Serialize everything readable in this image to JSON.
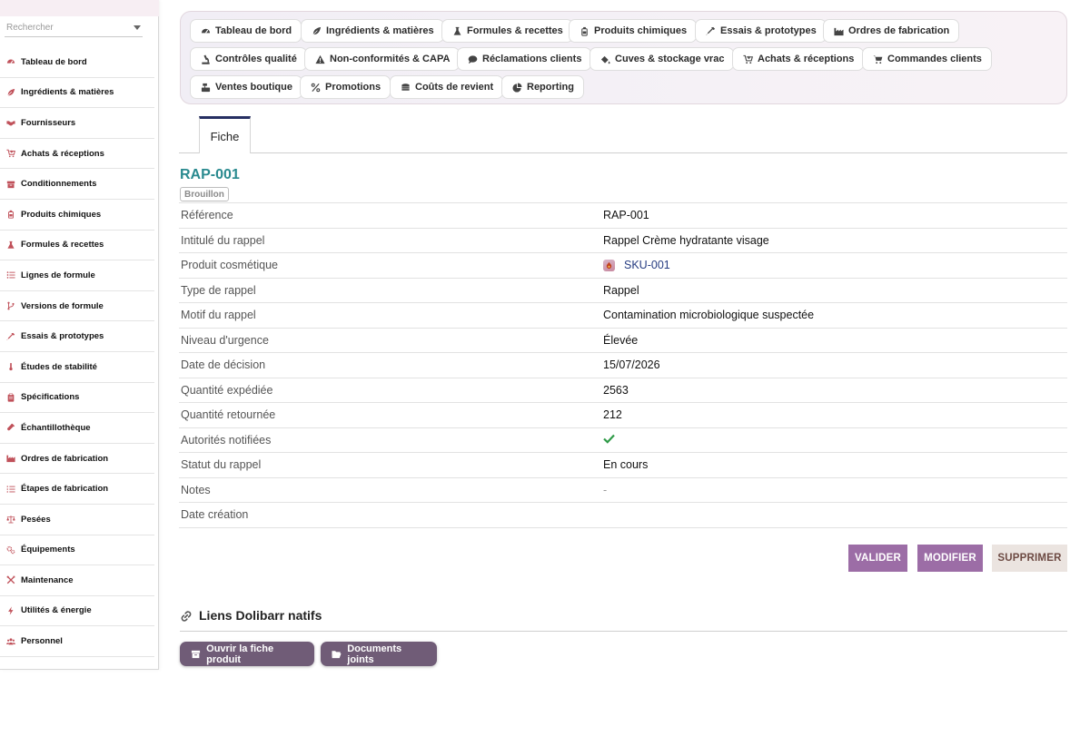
{
  "search": {
    "placeholder": "Rechercher"
  },
  "sidebar": {
    "items": [
      {
        "label": "Tableau de bord",
        "icon": "dashboard-icon"
      },
      {
        "label": "Ingrédients & matières",
        "icon": "leaf-icon"
      },
      {
        "label": "Fournisseurs",
        "icon": "handshake-icon"
      },
      {
        "label": "Achats & réceptions",
        "icon": "cart-arrow-icon"
      },
      {
        "label": "Conditionnements",
        "icon": "box-icon"
      },
      {
        "label": "Produits chimiques",
        "icon": "chemical-bottle-icon"
      },
      {
        "label": "Formules & recettes",
        "icon": "flask-icon"
      },
      {
        "label": "Lignes de formule",
        "icon": "list-icon"
      },
      {
        "label": "Versions de formule",
        "icon": "branch-icon"
      },
      {
        "label": "Essais & prototypes",
        "icon": "eyedropper-icon"
      },
      {
        "label": "Études de stabilité",
        "icon": "thermometer-icon"
      },
      {
        "label": "Spécifications",
        "icon": "clipboard-icon"
      },
      {
        "label": "Échantillothèque",
        "icon": "vial-icon"
      },
      {
        "label": "Ordres de fabrication",
        "icon": "factory-icon"
      },
      {
        "label": "Étapes de fabrication",
        "icon": "list-ol-icon"
      },
      {
        "label": "Pesées",
        "icon": "scale-icon"
      },
      {
        "label": "Équipements",
        "icon": "gears-icon"
      },
      {
        "label": "Maintenance",
        "icon": "tools-icon"
      },
      {
        "label": "Utilités & énergie",
        "icon": "bolt-icon"
      },
      {
        "label": "Personnel",
        "icon": "users-icon"
      }
    ]
  },
  "topmenu": {
    "buttons": [
      {
        "label": "Tableau de bord",
        "icon": "dashboard-icon"
      },
      {
        "label": "Ingrédients & matières",
        "icon": "leaf-icon"
      },
      {
        "label": "Formules & recettes",
        "icon": "flask-icon"
      },
      {
        "label": "Produits chimiques",
        "icon": "chemical-bottle-icon"
      },
      {
        "label": "Essais & prototypes",
        "icon": "eyedropper-icon"
      },
      {
        "label": "Ordres de fabrication",
        "icon": "factory-icon"
      },
      {
        "label": "Contrôles qualité",
        "icon": "microscope-icon"
      },
      {
        "label": "Non-conformités & CAPA",
        "icon": "warning-icon"
      },
      {
        "label": "Réclamations clients",
        "icon": "comment-icon"
      },
      {
        "label": "Cuves & stockage vrac",
        "icon": "fill-drip-icon"
      },
      {
        "label": "Achats & réceptions",
        "icon": "cart-arrow-icon"
      },
      {
        "label": "Commandes clients",
        "icon": "shopping-cart-icon"
      },
      {
        "label": "Ventes boutique",
        "icon": "cash-register-icon"
      },
      {
        "label": "Promotions",
        "icon": "percent-icon"
      },
      {
        "label": "Coûts de revient",
        "icon": "coins-icon"
      },
      {
        "label": "Reporting",
        "icon": "pie-chart-icon"
      }
    ]
  },
  "tabs": {
    "fiche": "Fiche"
  },
  "record": {
    "ref": "RAP-001",
    "status_badge": "Brouillon",
    "fields": [
      {
        "label": "Référence",
        "value": "RAP-001"
      },
      {
        "label": "Intitulé du rappel",
        "value": "Rappel Crème hydratante visage"
      },
      {
        "label": "Produit cosmétique",
        "value": "SKU-001",
        "type": "link"
      },
      {
        "label": "Type de rappel",
        "value": "Rappel"
      },
      {
        "label": "Motif du rappel",
        "value": "Contamination microbiologique suspectée"
      },
      {
        "label": "Niveau d'urgence",
        "value": "Élevée"
      },
      {
        "label": "Date de décision",
        "value": "15/07/2026"
      },
      {
        "label": "Quantité expédiée",
        "value": "2563"
      },
      {
        "label": "Quantité retournée",
        "value": "212"
      },
      {
        "label": "Autorités notifiées",
        "value": true,
        "type": "check"
      },
      {
        "label": "Statut du rappel",
        "value": "En cours"
      },
      {
        "label": "Notes",
        "value": "-",
        "type": "muted"
      },
      {
        "label": "Date création",
        "value": ""
      }
    ]
  },
  "actions": {
    "validate": "VALIDER",
    "edit": "MODIFIER",
    "delete": "SUPPRIMER"
  },
  "links": {
    "title": "Liens Dolibarr natifs",
    "open_product": "Ouvrir la fiche produit",
    "documents": "Documents joints"
  },
  "colors": {
    "ref_title": "#2a8a8f",
    "primary_button": "#9c6da6",
    "danger_button": "#ebe4e0",
    "link_pill": "#705c77",
    "check": "#2e9a47",
    "tab_active_border": "#262f62"
  }
}
